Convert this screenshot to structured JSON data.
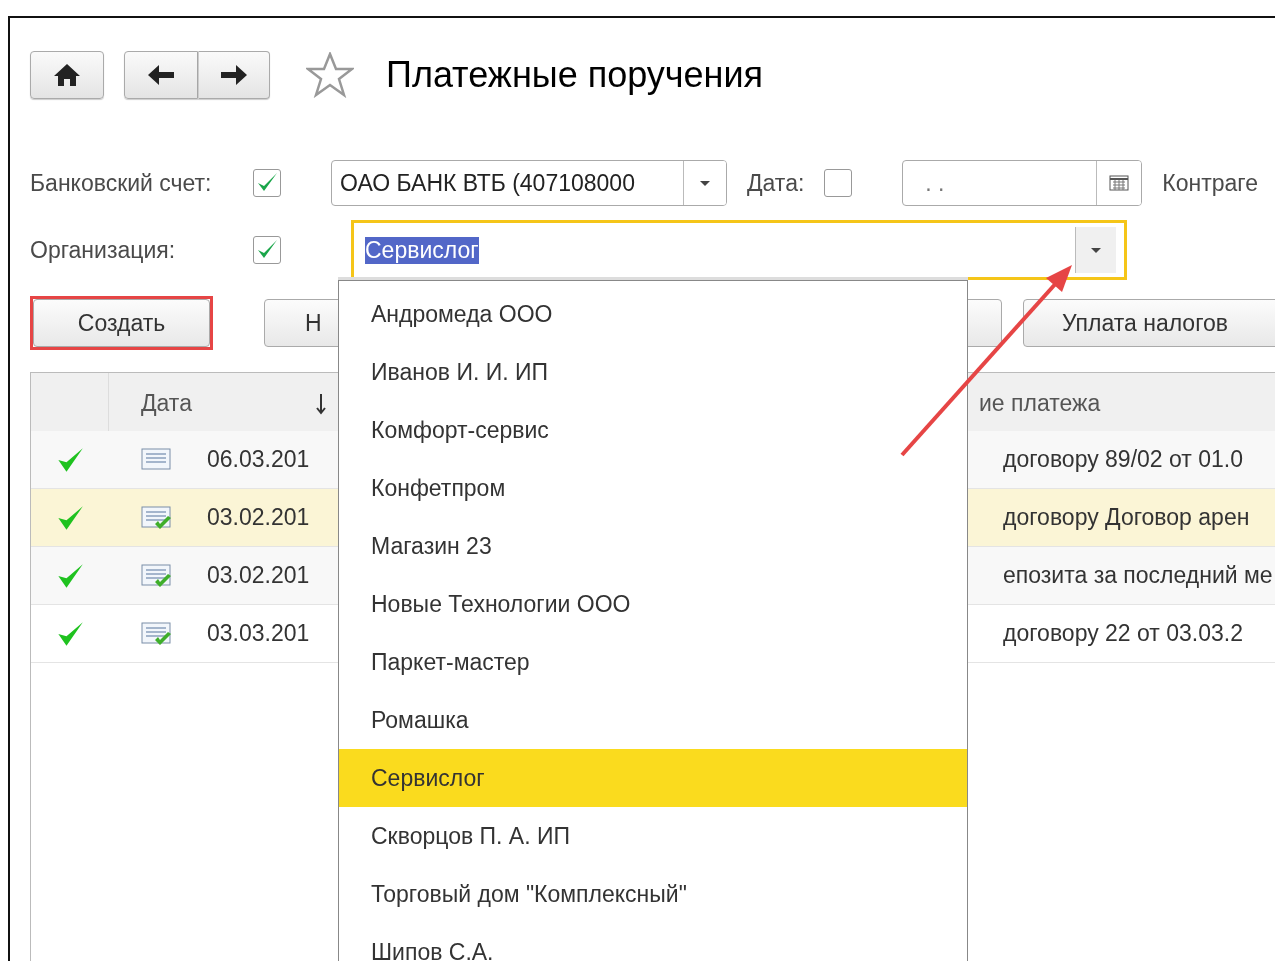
{
  "title": "Платежные поручения",
  "toolbar": {
    "favorite": false
  },
  "filters": {
    "bank_account": {
      "label": "Банковский счет:",
      "checked": true,
      "value": "ОАО БАНК ВТБ (407108000"
    },
    "date": {
      "label": "Дата:",
      "checked": false,
      "placeholder": ". ."
    },
    "counterparty": {
      "label": "Контраге"
    },
    "organization": {
      "label": "Организация:",
      "checked": true,
      "value": "Сервислог"
    }
  },
  "buttons": [
    {
      "label": "Создать",
      "kind": "highlighted"
    },
    {
      "label": "Н",
      "kind": "plain"
    },
    {
      "kind": "hidden"
    },
    {
      "label": "Уплата налогов",
      "kind": "plain"
    }
  ],
  "table": {
    "columns": [
      "Дата",
      "ие платежа"
    ],
    "rows": [
      {
        "posted": true,
        "doc_checked": false,
        "date": "06.03.201",
        "description": "договору 89/02 от 01.0",
        "selected": false
      },
      {
        "posted": true,
        "doc_checked": true,
        "date": "03.02.201",
        "description": "договору Договор арен",
        "selected": true
      },
      {
        "posted": true,
        "doc_checked": true,
        "date": "03.02.201",
        "description": "епозита за последний ме",
        "selected": false
      },
      {
        "posted": true,
        "doc_checked": true,
        "date": "03.03.201",
        "description": "договору 22 от 03.03.2",
        "selected": false
      }
    ]
  },
  "dropdown": {
    "items": [
      {
        "label": "Андромеда ООО",
        "selected": false
      },
      {
        "label": "Иванов И. И. ИП",
        "selected": false
      },
      {
        "label": "Комфорт-сервис",
        "selected": false
      },
      {
        "label": "Конфетпром",
        "selected": false
      },
      {
        "label": "Магазин 23",
        "selected": false
      },
      {
        "label": "Новые Технологии ООО",
        "selected": false
      },
      {
        "label": "Паркет-мастер",
        "selected": false
      },
      {
        "label": "Ромашка",
        "selected": false
      },
      {
        "label": "Сервислог",
        "selected": true
      },
      {
        "label": "Скворцов П. А. ИП",
        "selected": false
      },
      {
        "label": "Торговый дом \"Комплексный\"",
        "selected": false
      },
      {
        "label": "Шипов С.А.",
        "selected": false
      }
    ]
  }
}
